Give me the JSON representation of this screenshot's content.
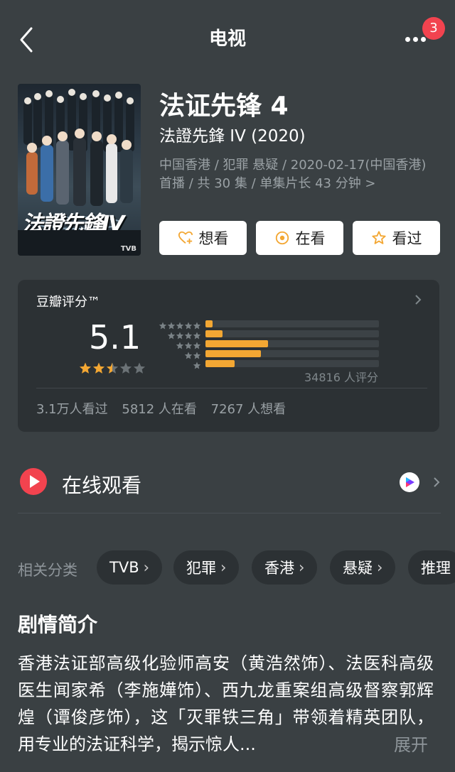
{
  "header": {
    "title": "电视",
    "badge_count": "3"
  },
  "movie": {
    "title": "法证先锋 4",
    "original_title": "法證先鋒 IV (2020)",
    "meta": "中国香港 / 犯罪 悬疑 / 2020-02-17(中国香港) 首播 / 共 30 集 / 单集片长 43 分钟 >",
    "poster": {
      "logo_text": "法證先鋒IV",
      "brand": "TVB"
    }
  },
  "actions": {
    "want": "想看",
    "watching": "在看",
    "watched": "看过"
  },
  "rating": {
    "label": "豆瓣评分™",
    "score": "5.1",
    "stars": 2.5,
    "count_text": "34816 人评分",
    "distribution": [
      {
        "stars": 5,
        "fraction": 0.04
      },
      {
        "stars": 4,
        "fraction": 0.1
      },
      {
        "stars": 3,
        "fraction": 0.36
      },
      {
        "stars": 2,
        "fraction": 0.32
      },
      {
        "stars": 1,
        "fraction": 0.17
      }
    ],
    "stats": {
      "seen": "3.1万人看过",
      "watching": "5812 人在看",
      "want": "7267 人想看"
    }
  },
  "watch_online": {
    "label": "在线观看",
    "provider_icon": "youku-icon"
  },
  "tags": {
    "label": "相关分类",
    "items": [
      "TVB",
      "犯罪",
      "香港",
      "悬疑",
      "推理"
    ]
  },
  "synopsis": {
    "title": "剧情简介",
    "text": "香港法证部高级化验师高安（黄浩然饰）、法医科高级医生闻家希（李施嬅饰）、西九龙重案组高级督察郭辉煌（谭俊彦饰），这「灭罪铁三角」带领着精英团队，用专业的法证科学，揭示惊人...",
    "expand_label": "展开"
  },
  "colors": {
    "background": "#3a4043",
    "card": "#2c3134",
    "accent_star": "#f3a733",
    "badge": "#f2434f",
    "play": "#f2434f"
  }
}
